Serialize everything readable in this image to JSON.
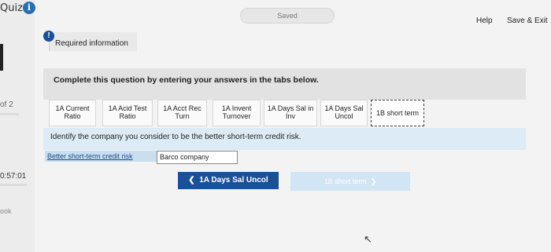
{
  "sidebar": {
    "quiz_label": "Quiz",
    "info_icon": "i",
    "progress_label": "of 2",
    "timer": "0:57:01",
    "book_label": "ook"
  },
  "header": {
    "saved_status": "Saved",
    "help": "Help",
    "save_exit": "Save & Exit"
  },
  "required": {
    "icon": "!",
    "label": "Required information"
  },
  "instruction": "Complete this question by entering your answers in the tabs below.",
  "tabs": [
    {
      "line1": "1A Current",
      "line2": "Ratio"
    },
    {
      "line1": "1A Acid Test",
      "line2": "Ratio"
    },
    {
      "line1": "1A Acct Rec",
      "line2": "Turn"
    },
    {
      "line1": "1A Invent",
      "line2": "Turnover"
    },
    {
      "line1": "1A Days Sal in",
      "line2": "Inv"
    },
    {
      "line1": "1A Days Sal",
      "line2": "Uncol"
    },
    {
      "line1": "1B short term",
      "line2": ""
    }
  ],
  "question": "Identify the company you consider to be the better short-term credit risk.",
  "answer": {
    "label": "Better short-term credit risk",
    "value": "Barco company"
  },
  "nav": {
    "prev_label": "1A Days Sal Uncol",
    "next_label": "1B short term"
  },
  "colors": {
    "accent": "#1b4f96",
    "band": "#dcebf5"
  }
}
